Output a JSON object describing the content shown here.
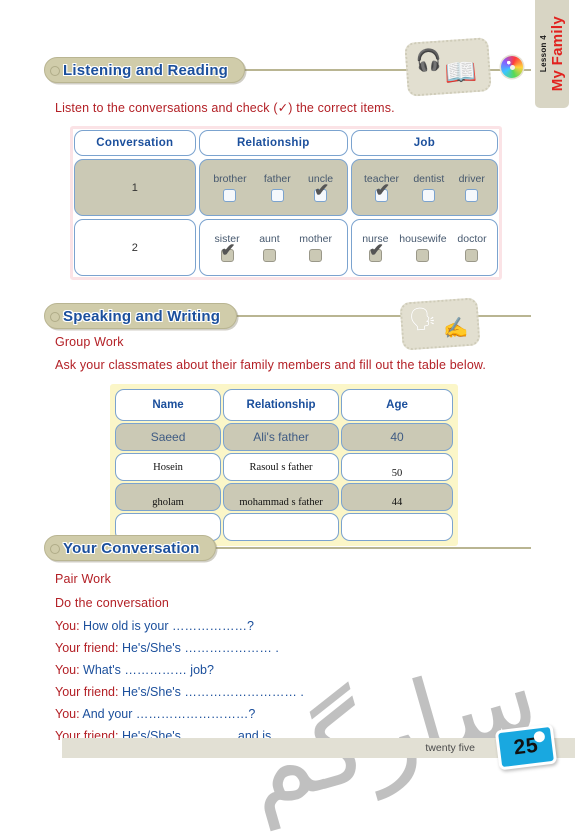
{
  "lesson_tab": {
    "lesson_no": "Lesson 4",
    "lesson_name": "My Family"
  },
  "icons": {
    "globe": "cd-disc-icon",
    "listening": "headphones-book-icon",
    "speaking": "speaking-head-writing-hand-icon"
  },
  "colors": {
    "heading_blue": "#1b4f9c",
    "instruction_red": "#b32026",
    "pill_tan": "#d0ccaa",
    "shaded_row": "#cbc9b5",
    "table1_border_pink": "#fbe3e6",
    "table2_border_yellow": "#fbf6c8",
    "page_badge_blue": "#19a8e0"
  },
  "sections": [
    {
      "title": "Listening and Reading"
    },
    {
      "title": "Speaking and Writing"
    },
    {
      "title": "Your Conversation"
    }
  ],
  "instructions": {
    "listening": "Listen to the conversations and check (✓) the correct items.",
    "group_work": "Group Work",
    "speaking": "Ask your classmates about their family members and fill out the table below.",
    "pair_work": "Pair Work",
    "do_conversation": "Do the conversation"
  },
  "table1": {
    "headers": [
      "Conversation",
      "Relationship",
      "Job"
    ],
    "rows": [
      {
        "number": "1",
        "shaded": true,
        "relationship": [
          {
            "label": "brother",
            "checked": false
          },
          {
            "label": "father",
            "checked": false
          },
          {
            "label": "uncle",
            "checked": true
          }
        ],
        "job": [
          {
            "label": "teacher",
            "checked": true
          },
          {
            "label": "dentist",
            "checked": false
          },
          {
            "label": "driver",
            "checked": false
          }
        ]
      },
      {
        "number": "2",
        "shaded": false,
        "relationship": [
          {
            "label": "sister",
            "checked": true
          },
          {
            "label": "aunt",
            "checked": false
          },
          {
            "label": "mother",
            "checked": false
          }
        ],
        "job": [
          {
            "label": "nurse",
            "checked": true
          },
          {
            "label": "housewife",
            "checked": false
          },
          {
            "label": "doctor",
            "checked": false
          }
        ]
      }
    ]
  },
  "table2": {
    "headers": [
      "Name",
      "Relationship",
      "Age"
    ],
    "rows": [
      {
        "name": "Saeed",
        "relationship": "Ali's father",
        "age": "40",
        "style": "print",
        "shaded": true
      },
      {
        "name": "Hosein",
        "relationship": "Rasoul s father",
        "age": "50",
        "style": "hand",
        "shaded": false
      },
      {
        "name": "gholam",
        "relationship": "mohammad s father",
        "age": "44",
        "style": "hand",
        "shaded": true
      },
      {
        "name": "",
        "relationship": "",
        "age": "",
        "style": "print",
        "shaded": false
      }
    ]
  },
  "conversation": [
    {
      "speaker": "You: ",
      "text": "How old is your ………………?"
    },
    {
      "speaker": "Your friend: ",
      "text": "He's/She's ………………… ."
    },
    {
      "speaker": "You: ",
      "text": "What's ……………  job?"
    },
    {
      "speaker": "Your friend: ",
      "text": "He's/She's ……………………… ."
    },
    {
      "speaker": "You: ",
      "text": "And your ………………………?"
    },
    {
      "speaker": "Your friend: ",
      "text": "He's/She's ………… and is …………………… ."
    }
  ],
  "footer": {
    "page_word": "twenty five",
    "page_number": "25"
  },
  "watermark": {
    "text": "سارگم"
  }
}
